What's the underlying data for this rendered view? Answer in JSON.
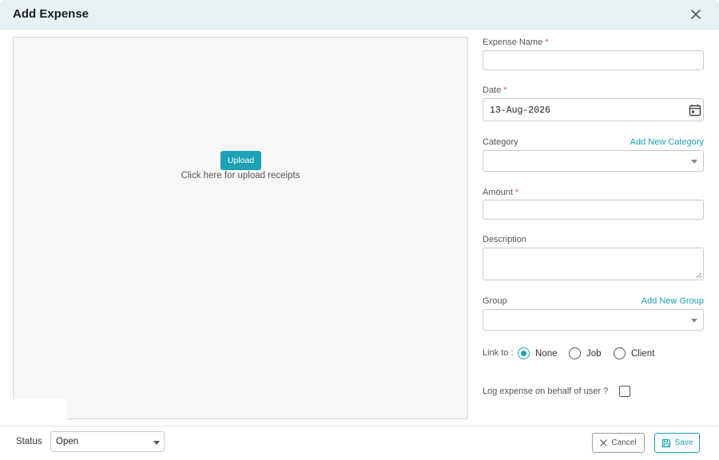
{
  "header": {
    "title": "Add Expense",
    "close_icon": "close-icon"
  },
  "upload": {
    "button_label": "Upload",
    "hint": "Click here for upload receipts"
  },
  "form": {
    "expense_name": {
      "label": "Expense Name",
      "required_mark": "*",
      "value": ""
    },
    "date": {
      "label": "Date",
      "required_mark": "*",
      "value": "13-Aug-2026",
      "icon": "calendar-icon"
    },
    "category": {
      "label": "Category",
      "link": "Add New Category",
      "value": ""
    },
    "amount": {
      "label": "Amount",
      "required_mark": "*",
      "value": ""
    },
    "description": {
      "label": "Description",
      "value": ""
    },
    "group": {
      "label": "Group",
      "link": "Add New Group",
      "value": ""
    },
    "link_to": {
      "label": "Link to :",
      "options": [
        "None",
        "Job",
        "Client"
      ],
      "selected": "None"
    },
    "behalf": {
      "label": "Log expense on behalf of user ?",
      "checked": false
    }
  },
  "footer": {
    "status_label": "Status",
    "status_value": "Open",
    "cancel_label": "Cancel",
    "save_label": "Save"
  },
  "colors": {
    "accent": "#1ea0b5",
    "required": "#d9534f",
    "header_bg": "#e8f1f3"
  }
}
